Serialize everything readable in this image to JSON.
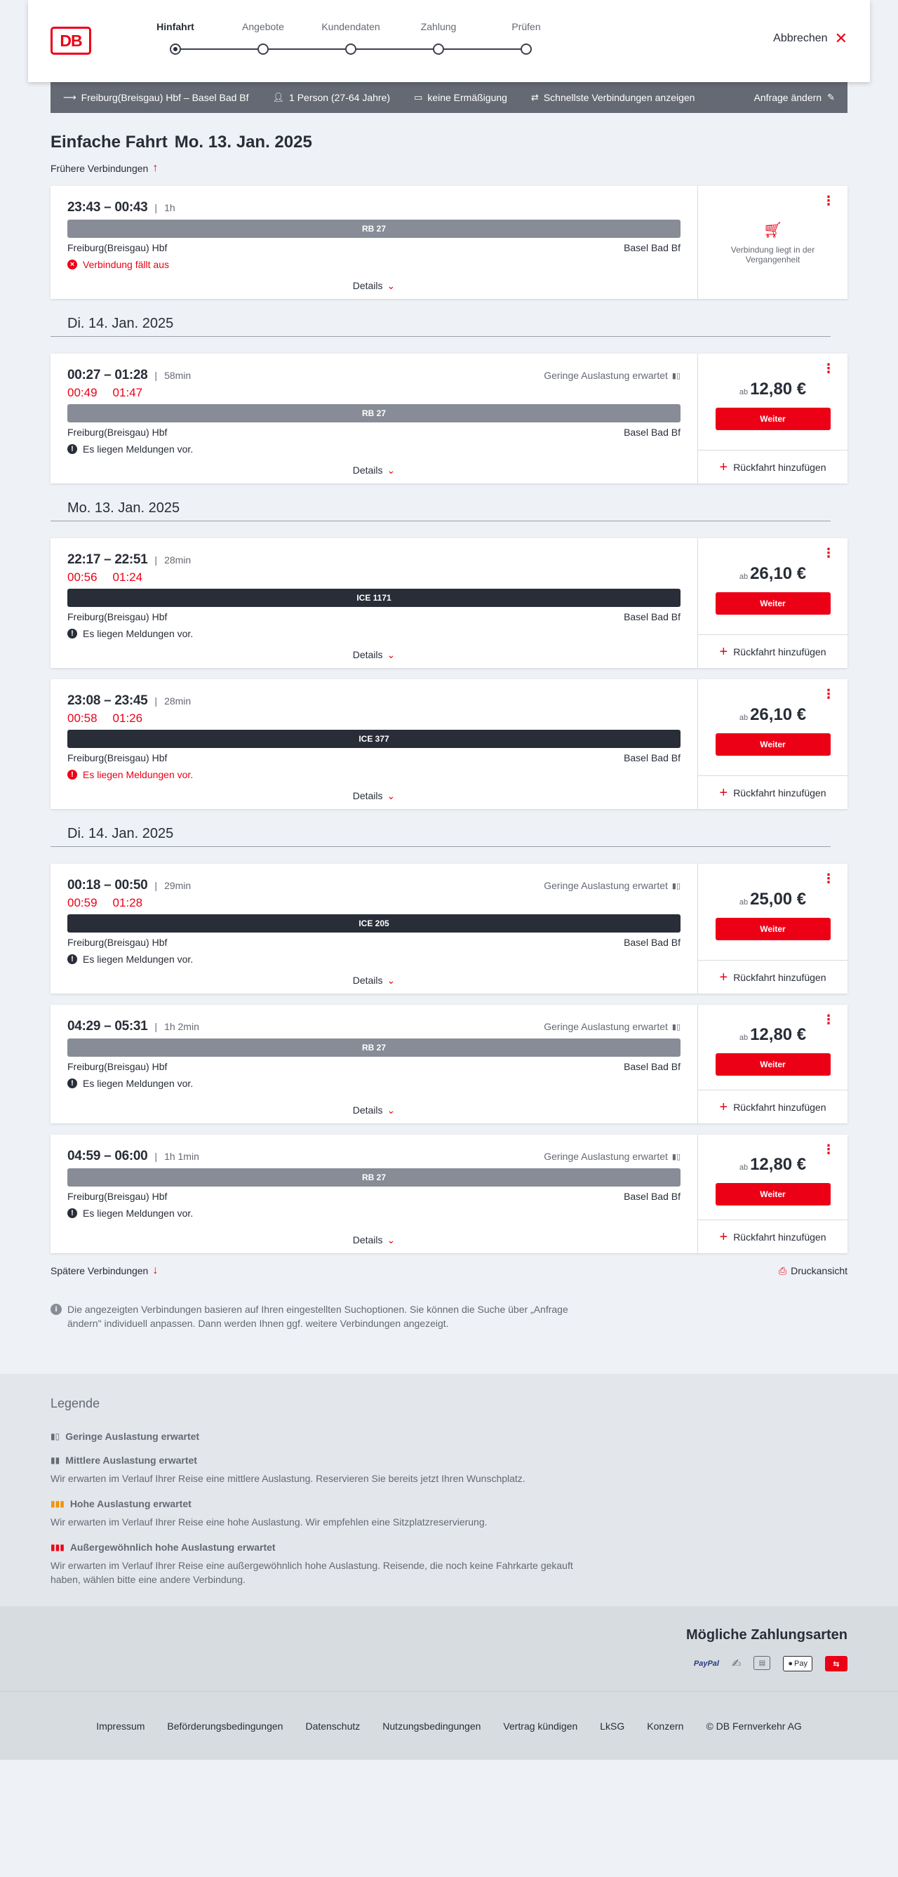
{
  "header": {
    "logo": "DB",
    "steps": [
      "Hinfahrt",
      "Angebote",
      "Kundendaten",
      "Zahlung",
      "Prüfen"
    ],
    "active_step": "Hinfahrt",
    "cancel_label": "Abbrechen"
  },
  "searchbar": {
    "route": "Freiburg(Breisgau) Hbf – Basel Bad Bf",
    "passengers": "1 Person (27-64 Jahre)",
    "discount": "keine Ermäßigung",
    "option": "Schnellste Verbindungen anzeigen",
    "edit": "Anfrage ändern"
  },
  "main": {
    "title_bold": "Einfache Fahrt",
    "title_date": "Mo. 13. Jan. 2025",
    "earlier": "Frühere Verbindungen",
    "later": "Spätere Verbindungen",
    "print": "Druckansicht",
    "info": "Die angezeigten Verbindungen basieren auf Ihren eingestellten Suchoptionen. Sie können die Suche über „Anfrage ändern\" individuell anpassen. Dann werden Ihnen ggf. weitere Verbindungen angezeigt."
  },
  "common": {
    "details": "Details",
    "weiter": "Weiter",
    "return": "Rückfahrt hinzufügen",
    "ab": "ab",
    "from": "Freiburg(Breisgau) Hbf",
    "to": "Basel Bad Bf",
    "load_low": "Geringe Auslastung erwartet",
    "past": "Verbindung liegt in der Vergangenheit"
  },
  "connections": [
    {
      "time": "23:43 – 00:43",
      "duration": "1h",
      "train": "RB 27",
      "status": "Verbindung fällt aus"
    },
    {
      "date_heading": "Di. 14. Jan. 2025"
    },
    {
      "time": "00:27 – 01:28",
      "duration": "58min",
      "delay_dep": "00:49",
      "delay_arr": "01:47",
      "train": "RB 27",
      "message": "Es liegen Meldungen vor.",
      "price": "12,80 €"
    },
    {
      "date_heading": "Mo. 13. Jan. 2025"
    },
    {
      "time": "22:17 – 22:51",
      "duration": "28min",
      "delay_dep": "00:56",
      "delay_arr": "01:24",
      "train": "ICE 1171",
      "message": "Es liegen Meldungen vor.",
      "price": "26,10 €"
    },
    {
      "time": "23:08 – 23:45",
      "duration": "28min",
      "delay_dep": "00:58",
      "delay_arr": "01:26",
      "train": "ICE 377",
      "message": "Es liegen Meldungen vor.",
      "price": "26,10 €"
    },
    {
      "date_heading": "Di. 14. Jan. 2025"
    },
    {
      "time": "00:18 – 00:50",
      "duration": "29min",
      "delay_dep": "00:59",
      "delay_arr": "01:28",
      "train": "ICE 205",
      "message": "Es liegen Meldungen vor.",
      "price": "25,00 €"
    },
    {
      "time": "04:29 – 05:31",
      "duration": "1h 2min",
      "train": "RB 27",
      "message": "Es liegen Meldungen vor.",
      "price": "12,80 €"
    },
    {
      "time": "04:59 – 06:00",
      "duration": "1h 1min",
      "train": "RB 27",
      "message": "Es liegen Meldungen vor.",
      "price": "12,80 €"
    }
  ],
  "legend": {
    "title": "Legende",
    "items": [
      {
        "label": "Geringe Auslastung erwartet",
        "desc": ""
      },
      {
        "label": "Mittlere Auslastung erwartet",
        "desc": "Wir erwarten im Verlauf Ihrer Reise eine mittlere Auslastung. Reservieren Sie bereits jetzt Ihren Wunschplatz."
      },
      {
        "label": "Hohe Auslastung erwartet",
        "desc": "Wir erwarten im Verlauf Ihrer Reise eine hohe Auslastung. Wir empfehlen eine Sitzplatzreservierung."
      },
      {
        "label": "Außergewöhnlich hohe Auslastung erwartet",
        "desc": "Wir erwarten im Verlauf Ihrer Reise eine außergewöhnlich hohe Auslastung. Reisende, die noch keine Fahrkarte gekauft haben, wählen bitte eine andere Verbindung."
      }
    ]
  },
  "payments": {
    "title": "Mögliche Zahlungsarten",
    "paypal": "PayPal",
    "apple": "Pay"
  },
  "footer": {
    "links": [
      "Impressum",
      "Beförderungsbedingungen",
      "Datenschutz",
      "Nutzungsbedingungen",
      "Vertrag kündigen",
      "LkSG",
      "Konzern",
      "© DB Fernverkehr AG"
    ]
  },
  "colors": {
    "accent": "#ec0016",
    "dark": "#282d37",
    "grey_bar": "#646973"
  }
}
